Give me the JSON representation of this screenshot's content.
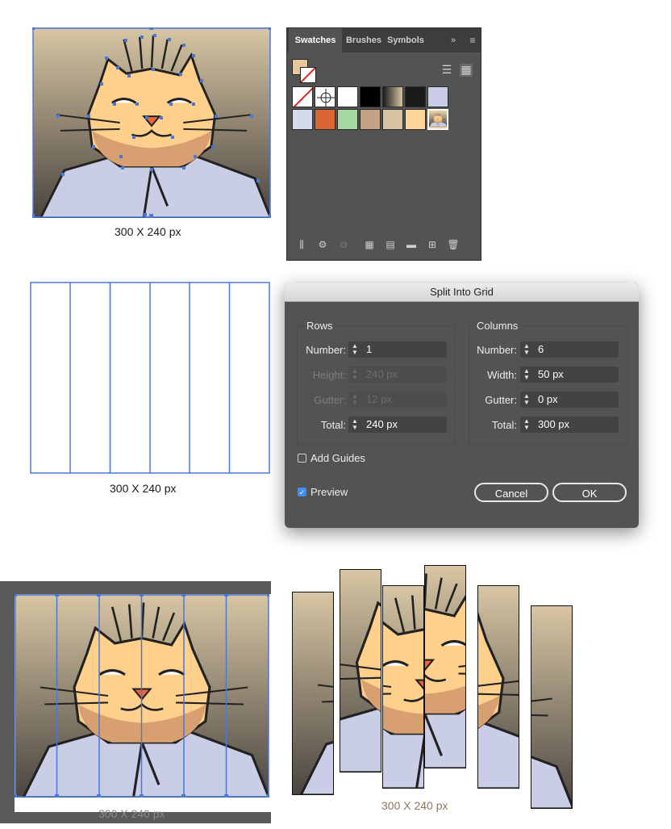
{
  "captions": {
    "top": "300 X 240 px",
    "middle": "300 X 240 px",
    "bottom_left": "300 X 240 px",
    "bottom_right": "300 X 240 px"
  },
  "swatches_panel": {
    "tabs": [
      "Swatches",
      "Brushes",
      "Symbols"
    ],
    "overflow_icon": "chevron-double-right",
    "menu_icon": "hamburger",
    "swatch_colors": [
      "#ffffff",
      "#ffffff",
      "#000000",
      "#8a7a5e",
      "#1a1a1a",
      "#c9cde6",
      "#d6daee",
      "#dc6631",
      "#a6d8a2",
      "#c4a285",
      "#d6c3a2",
      "#ffd69a"
    ]
  },
  "dialog": {
    "title": "Split Into Grid",
    "rows": {
      "heading": "Rows",
      "number_label": "Number:",
      "number": "1",
      "height_label": "Height:",
      "height": "240 px",
      "gutter_label": "Gutter:",
      "gutter": "12 px",
      "total_label": "Total:",
      "total": "240 px"
    },
    "columns": {
      "heading": "Columns",
      "number_label": "Number:",
      "number": "6",
      "width_label": "Width:",
      "width": "50 px",
      "gutter_label": "Gutter:",
      "gutter": "0 px",
      "total_label": "Total:",
      "total": "300 px"
    },
    "add_guides": "Add Guides",
    "add_guides_checked": false,
    "preview": "Preview",
    "preview_checked": true,
    "cancel": "Cancel",
    "ok": "OK"
  },
  "colors": {
    "selection": "#4a78d8",
    "panel_bg": "#535353",
    "accent": "#3d8ef6"
  }
}
